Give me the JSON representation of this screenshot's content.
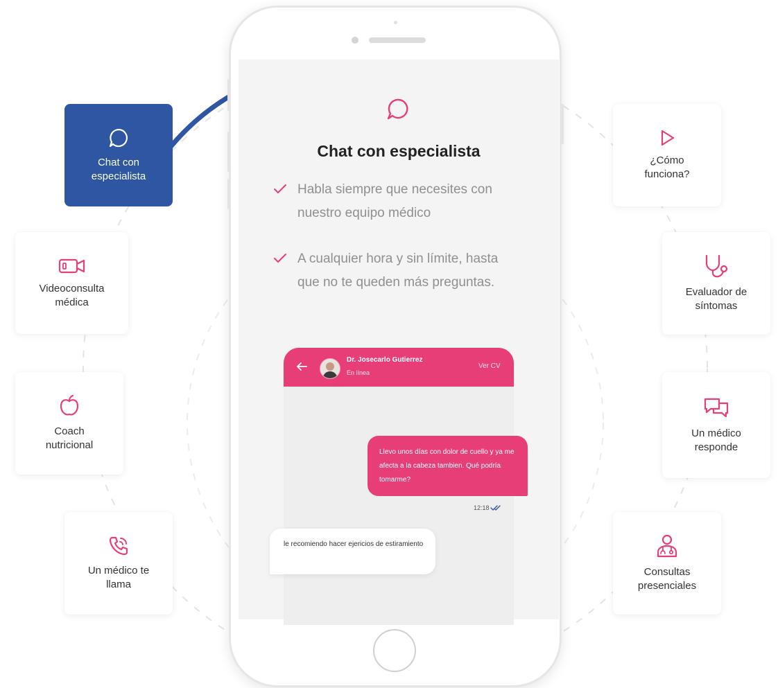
{
  "colors": {
    "accent": "#e83e78",
    "active_card": "#2e56a3",
    "text_grey": "#8f8f8f"
  },
  "cards": [
    {
      "label": "Chat con\nespecialista",
      "icon": "chat-bubble-icon",
      "active": true
    },
    {
      "label": "Videoconsulta\nmédica",
      "icon": "video-camera-icon"
    },
    {
      "label": "Coach\nnutricional",
      "icon": "apple-icon"
    },
    {
      "label": "Un médico te\nllama",
      "icon": "phone-call-icon"
    },
    {
      "label": "¿Cómo\nfunciona?",
      "icon": "play-icon"
    },
    {
      "label": "Evaluador de\nsíntomas",
      "icon": "stethoscope-icon"
    },
    {
      "label": "Un médico\nresponde",
      "icon": "chat-bubbles-icon"
    },
    {
      "label": "Consultas\npresenciales",
      "icon": "doctor-icon"
    }
  ],
  "screen": {
    "icon": "chat-bubble-icon",
    "title": "Chat con especialista",
    "bullets": [
      "Habla siempre que necesites con nuestro equipo médico",
      "A cualquier hora y sin límite, hasta que no te queden más preguntas."
    ]
  },
  "chat": {
    "doctor_name": "Dr. Josecarlo Gutierrez",
    "status": "En línea",
    "ver_cv": "Ver CV",
    "message_out": "Llevo unos días con dolor de cuello y ya me afecta a la cabeza tambien. Qué podría tomarme?",
    "time": "12:18",
    "message_in": "le recomiendo hacer ejericios de estiramiento"
  }
}
